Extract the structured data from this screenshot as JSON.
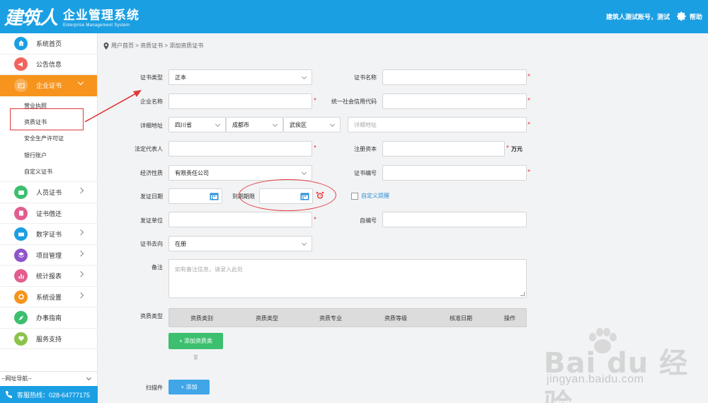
{
  "header": {
    "logo_mark": "建筑人",
    "title": "企业管理系统",
    "subtitle": "Enterprise Management System",
    "user": "建筑人测试账号，测试",
    "help": "帮助"
  },
  "sidebar": {
    "items": [
      {
        "label": "系统首页",
        "icon": "home-icon",
        "color": "#1b9fe3"
      },
      {
        "label": "公告信息",
        "icon": "megaphone-icon",
        "color": "#f0655d"
      },
      {
        "label": "企业证书",
        "icon": "certificate-icon",
        "color": "#f7941d"
      },
      {
        "label": "人员证书",
        "icon": "person-card-icon",
        "color": "#3cbf6e"
      },
      {
        "label": "证书借还",
        "icon": "exchange-icon",
        "color": "#e35d8f"
      },
      {
        "label": "数字证书",
        "icon": "digital-cert-icon",
        "color": "#1b9fe3"
      },
      {
        "label": "项目管理",
        "icon": "layers-icon",
        "color": "#8e55c9"
      },
      {
        "label": "统计报表",
        "icon": "chart-icon",
        "color": "#e35d8f"
      },
      {
        "label": "系统设置",
        "icon": "gear-icon",
        "color": "#f7941d"
      },
      {
        "label": "办事指南",
        "icon": "compass-icon",
        "color": "#3cbf6e"
      },
      {
        "label": "服务支持",
        "icon": "heart-icon",
        "color": "#8bc34a"
      }
    ],
    "submenu": [
      "营业执照",
      "资质证书",
      "安全生产许可证",
      "银行账户",
      "自定义证书"
    ],
    "nav_select": "--网址导航--",
    "hotline": "客服热线：028-64777175"
  },
  "breadcrumb": "用户首页 > 资质证书 > 添加资质证书",
  "form": {
    "cert_type_label": "证书类型",
    "cert_type_value": "正本",
    "cert_name_label": "证书名称",
    "company_label": "企业名称",
    "credit_code_label": "统一社会信用代码",
    "address_label": "详细地址",
    "province": "四川省",
    "city": "成都市",
    "district": "武侯区",
    "address_placeholder": "详细地址",
    "legal_label": "法定代表人",
    "capital_label": "注册资本",
    "capital_unit": "万元",
    "nature_label": "经济性质",
    "nature_value": "有限责任公司",
    "cert_no_label": "证书编号",
    "issue_date_label": "发证日期",
    "expire_label": "到期期限",
    "custom_remind": "自定义提醒",
    "issuer_label": "发证单位",
    "self_no_label": "自编号",
    "direction_label": "证书去向",
    "direction_value": "在册",
    "remark_label": "备注",
    "remark_placeholder": "如有备注信息，请录入此处",
    "qual_label": "资质类型",
    "qual_columns": [
      "资质类别",
      "资质类型",
      "资质专业",
      "资质等级",
      "核准日期",
      "操作"
    ],
    "add_qual_button": "+ 添加资质类",
    "scan_label": "扫描件",
    "add_button": "+ 添加",
    "required_mark": "*"
  },
  "watermark": {
    "brand": "Bai du 经验",
    "url": "jingyan.baidu.com"
  },
  "colors": {
    "primary": "#1b9fe3",
    "accent": "#f7941d",
    "success": "#3cbf6e",
    "annotation": "#e03a3a"
  }
}
